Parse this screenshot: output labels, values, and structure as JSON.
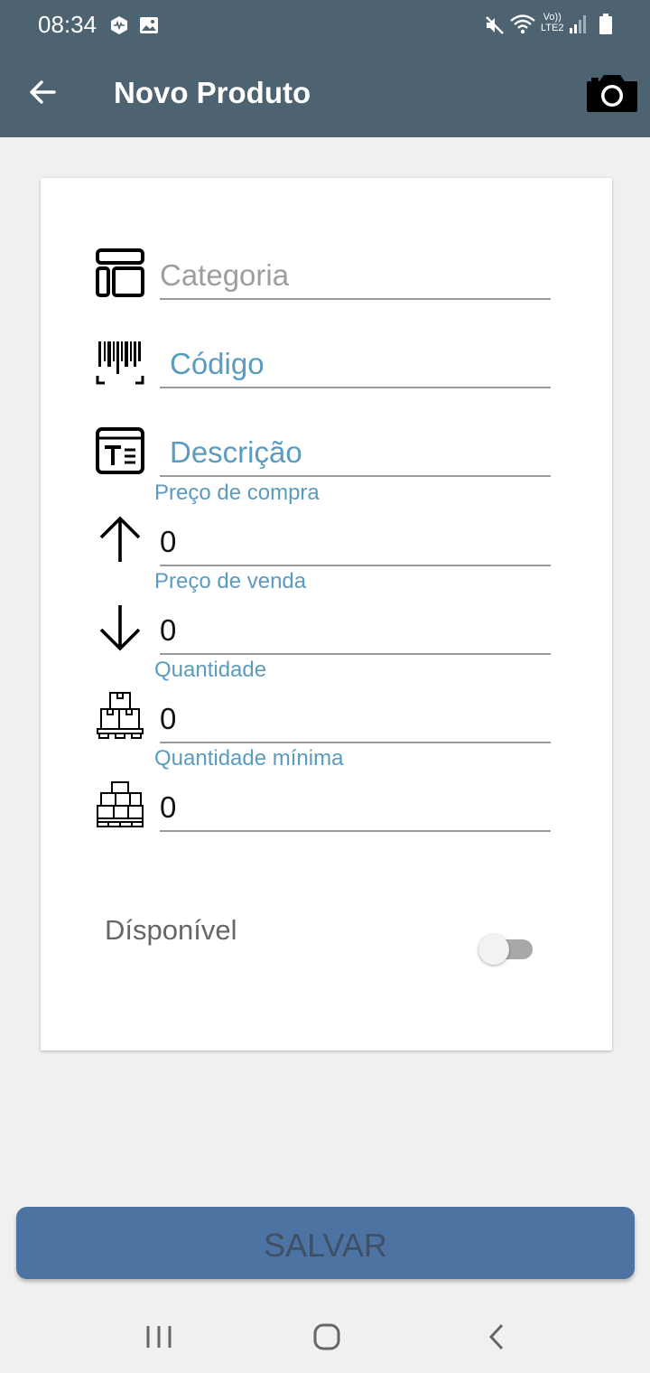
{
  "status_bar": {
    "time": "08:34",
    "network_label_top": "Vo))",
    "network_label_bottom": "LTE2"
  },
  "app_bar": {
    "title": "Novo Produto",
    "back_icon": "arrow-left-icon",
    "action_icon": "camera-icon"
  },
  "form": {
    "categoria": {
      "placeholder": "Categoria",
      "icon": "layout-icon"
    },
    "codigo": {
      "placeholder": "Código",
      "icon": "barcode-icon"
    },
    "descricao": {
      "placeholder": "Descrição",
      "icon": "text-document-icon"
    },
    "preco_compra": {
      "label": "Preço de compra",
      "value": "0",
      "icon": "arrow-up-icon"
    },
    "preco_venda": {
      "label": "Preço de venda",
      "value": "0",
      "icon": "arrow-down-icon"
    },
    "quantidade": {
      "label": "Quantidade",
      "value": "0",
      "icon": "boxes-pallet-icon"
    },
    "quantidade_minima": {
      "label": "Quantidade mínima",
      "value": "0",
      "icon": "boxes-pallet-stack-icon"
    },
    "disponivel": {
      "label": "Dísponível",
      "enabled": false
    }
  },
  "actions": {
    "save_label": "SALVAR"
  },
  "colors": {
    "app_bar": "#4d6371",
    "accent_label": "#5b9bbf",
    "save_button": "#4d73a3"
  }
}
